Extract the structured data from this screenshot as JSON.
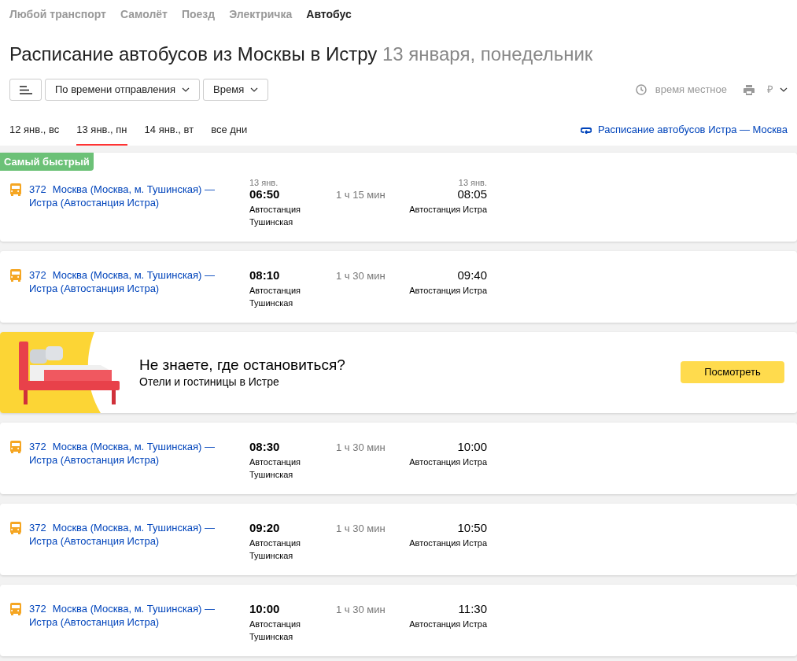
{
  "transport_tabs": [
    {
      "label": "Любой транспорт",
      "selected": false
    },
    {
      "label": "Самолёт",
      "selected": false
    },
    {
      "label": "Поезд",
      "selected": false
    },
    {
      "label": "Электричка",
      "selected": false
    },
    {
      "label": "Автобус",
      "selected": true
    }
  ],
  "title": {
    "main": "Расписание автобусов из Москвы в Истру",
    "date": "13 января, понедельник"
  },
  "toolbar": {
    "sort": "По времени отправления",
    "time_filter": "Время",
    "timezone": "время местное",
    "currency": "₽"
  },
  "date_tabs": [
    {
      "label": "12 янв., вс",
      "selected": false
    },
    {
      "label": "13 янв., пн",
      "selected": true
    },
    {
      "label": "14 янв., вт",
      "selected": false
    },
    {
      "label": "все дни",
      "selected": false
    }
  ],
  "reverse_link": "Расписание автобусов Истра — Москва",
  "results": [
    {
      "kind": "trip",
      "badge": "Самый быстрый",
      "number": "372",
      "route": "Москва (Москва, м. Тушинская) — Истра (Автостанция Истра)",
      "dep_date": "13 янв.",
      "dep_time": "06:50",
      "dep_station": "Автостанция Тушинская",
      "duration": "1 ч 15 мин",
      "arr_date": "13 янв.",
      "arr_time": "08:05",
      "arr_station": "Автостанция Истра"
    },
    {
      "kind": "trip",
      "number": "372",
      "route": "Москва (Москва, м. Тушинская) — Истра (Автостанция Истра)",
      "dep_time": "08:10",
      "dep_station": "Автостанция Тушинская",
      "duration": "1 ч 30 мин",
      "arr_time": "09:40",
      "arr_station": "Автостанция Истра"
    },
    {
      "kind": "ad",
      "title": "Не знаете, где остановиться?",
      "subtitle": "Отели и гостиницы в Истре",
      "button": "Посмотреть"
    },
    {
      "kind": "trip",
      "number": "372",
      "route": "Москва (Москва, м. Тушинская) — Истра (Автостанция Истра)",
      "dep_time": "08:30",
      "dep_station": "Автостанция Тушинская",
      "duration": "1 ч 30 мин",
      "arr_time": "10:00",
      "arr_station": "Автостанция Истра"
    },
    {
      "kind": "trip",
      "number": "372",
      "route": "Москва (Москва, м. Тушинская) — Истра (Автостанция Истра)",
      "dep_time": "09:20",
      "dep_station": "Автостанция Тушинская",
      "duration": "1 ч 30 мин",
      "arr_time": "10:50",
      "arr_station": "Автостанция Истра"
    },
    {
      "kind": "trip",
      "number": "372",
      "route": "Москва (Москва, м. Тушинская) — Истра (Автостанция Истра)",
      "dep_time": "10:00",
      "dep_station": "Автостанция Тушинская",
      "duration": "1 ч 30 мин",
      "arr_time": "11:30",
      "arr_station": "Автостанция Истра"
    }
  ]
}
